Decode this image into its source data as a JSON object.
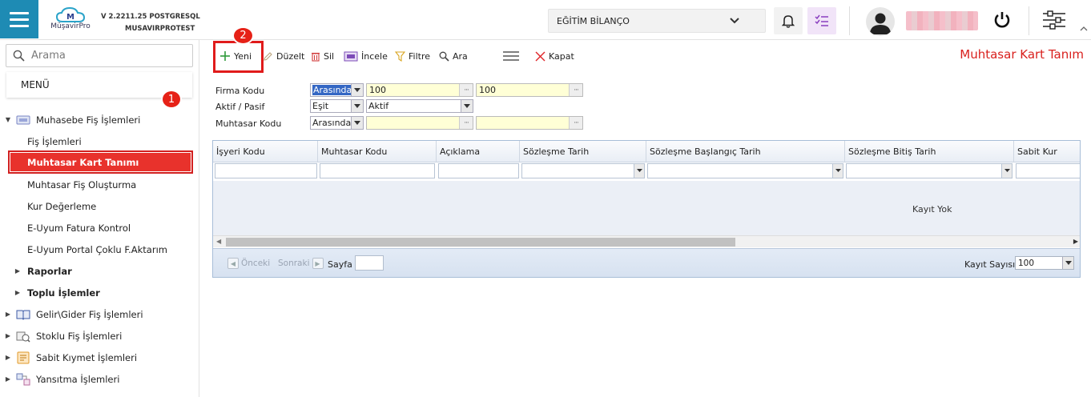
{
  "header": {
    "logo_text": "MüşavirPro",
    "version": "V 2.2211.25 POSTGRESQL",
    "db_name": "MUSAVIRPROTEST",
    "company_selected": "EĞİTİM BİLANÇO"
  },
  "sidebar": {
    "search_placeholder": "Arama",
    "menu_title": "MENÜ",
    "items": [
      {
        "label": "Muhasebe Fiş İşlemleri",
        "icon": "ledger-icon",
        "level": 0,
        "expanded": true
      },
      {
        "label": "Fiş İşlemleri",
        "level": 1
      },
      {
        "label": "Muhtasar Kart Tanımı",
        "level": 1,
        "active": true
      },
      {
        "label": "Muhtasar Fiş Oluşturma",
        "level": 1
      },
      {
        "label": "Kur Değerleme",
        "level": 1
      },
      {
        "label": "E-Uyum Fatura Kontrol",
        "level": 1
      },
      {
        "label": "E-Uyum Portal Çoklu F.Aktarım",
        "level": 1
      },
      {
        "label": "Raporlar",
        "level": 1,
        "bold": true
      },
      {
        "label": "Toplu İşlemler",
        "level": 1,
        "bold": true
      },
      {
        "label": "Gelir\\Gider Fiş İşlemleri",
        "icon": "book-icon",
        "level": 0
      },
      {
        "label": "Stoklu Fiş İşlemleri",
        "icon": "stock-icon",
        "level": 0
      },
      {
        "label": "Sabit Kıymet İşlemleri",
        "icon": "asset-icon",
        "level": 0
      },
      {
        "label": "Yansıtma İşlemleri",
        "icon": "reflect-icon",
        "level": 0
      }
    ]
  },
  "annotations": {
    "badge1": "1",
    "badge2": "2"
  },
  "toolbar": {
    "new": "Yeni",
    "edit": "Düzelt",
    "delete": "Sil",
    "inspect": "İncele",
    "filter": "Filtre",
    "search": "Ara",
    "close": "Kapat",
    "page_title": "Muhtasar Kart Tanım"
  },
  "form": {
    "firma_kodu": {
      "label": "Firma Kodu",
      "operator": "Arasında",
      "from": "100",
      "to": "100"
    },
    "aktif_pasif": {
      "label": "Aktif / Pasif",
      "operator": "Eşit",
      "value": "Aktif"
    },
    "muhtasar_kodu": {
      "label": "Muhtasar Kodu",
      "operator": "Arasında",
      "from": "",
      "to": ""
    }
  },
  "grid": {
    "columns": [
      "İşyeri Kodu",
      "Muhtasar Kodu",
      "Açıklama",
      "Sözleşme Tarih",
      "Sözleşme Başlangıç Tarih",
      "Sözleşme Bitiş Tarih",
      "Sabit Kur"
    ],
    "empty_text": "Kayıt Yok",
    "pager": {
      "prev": "Önceki",
      "next": "Sonraki",
      "page_label": "Sayfa",
      "page_value": "",
      "records_label": "Kayıt Sayısı",
      "records_value": "100"
    }
  },
  "colors": {
    "brand": "#1e8bb4",
    "active_menu": "#e8322c",
    "title_red": "#d9211e"
  }
}
